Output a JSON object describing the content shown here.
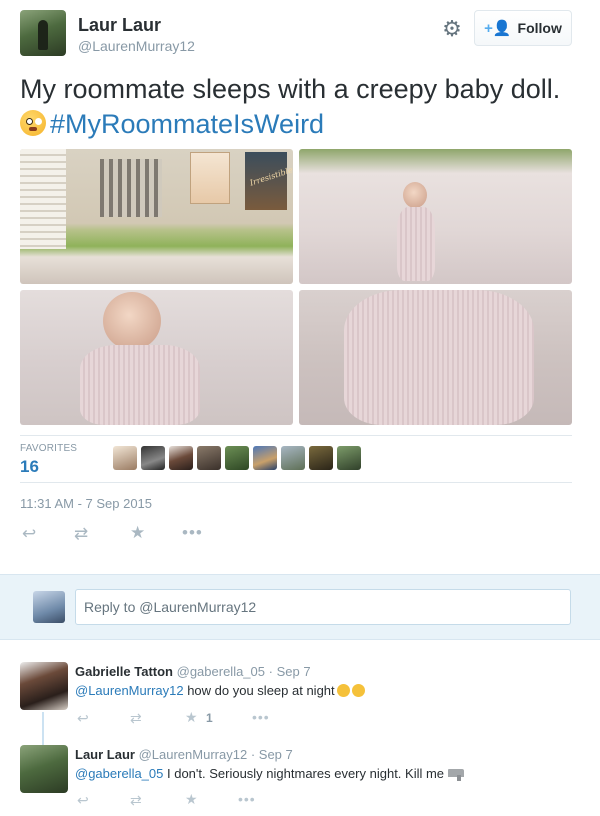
{
  "tweet": {
    "author_name": "Laur Laur",
    "author_handle": "@LaurenMurray12",
    "follow_label": "Follow",
    "text": "My roommate sleeps with a creepy baby doll.",
    "hashtag": "#MyRoommateIsWeird",
    "favorites_label": "FAVORITES",
    "favorites_count": "16",
    "timestamp": "11:31 AM - 7 Sep 2015",
    "poster_text": "Irresistible"
  },
  "icons": {
    "settings": "gear-icon",
    "follow": "follow-user-icon",
    "reply": "reply-icon",
    "retweet": "retweet-icon",
    "favorite": "star-icon",
    "more": "more-icon"
  },
  "reply_box": {
    "placeholder": "Reply to @LaurenMurray12"
  },
  "replies": [
    {
      "name": "Gabrielle Tatton",
      "handle": "@gaberella_05",
      "date": "Sep 7",
      "mention": "@LaurenMurray12",
      "text": " how do you sleep at night",
      "fav_count": "1"
    },
    {
      "name": "Laur Laur",
      "handle": "@LaurenMurray12",
      "date": "Sep 7",
      "mention": "@gaberella_05",
      "text": " I don't. Seriously nightmares every night. Kill me",
      "fav_count": ""
    }
  ],
  "colors": {
    "link": "#2b7bb9",
    "muted": "#8899a6",
    "follow_icon": "#55acee",
    "reply_panel": "#e9f3f9"
  }
}
